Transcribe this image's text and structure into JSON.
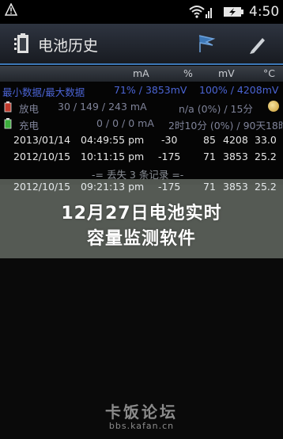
{
  "status_bar": {
    "time": "4:50"
  },
  "app_bar": {
    "title": "电池历史"
  },
  "table": {
    "columns": [
      "mA",
      "%",
      "mV",
      "°C"
    ],
    "max_min": {
      "label": "最小数据/最大数据",
      "pct": "71% / 3853mV",
      "mv": "100% / 4208mV"
    },
    "discharge": {
      "label": "放电",
      "values": "30 / 149 / 243 mA",
      "rate": "n/a (0%) / 15分"
    },
    "charge": {
      "label": "充电",
      "values": "0 / 0 / 0 mA",
      "rate": "2时10分 (0%) / 90天18时"
    },
    "rows": [
      {
        "date": "2013/01/14",
        "time": "04:49:55 pm",
        "ma": "-30",
        "pct": "85",
        "mv": "4208",
        "temp": "33.0"
      },
      {
        "date": "2012/10/15",
        "time": "10:11:15 pm",
        "ma": "-175",
        "pct": "71",
        "mv": "3853",
        "temp": "25.2"
      }
    ],
    "lost": "-= 丢失 3 条记录 =-",
    "partial_row": {
      "date": "2012/10/15",
      "time": "09:21:13 pm",
      "ma": "-175",
      "pct": "71",
      "mv": "3853",
      "temp": "25.2"
    }
  },
  "headline": {
    "line1": "12月27日电池实时",
    "line2": "容量监测软件"
  },
  "watermark": {
    "name": "卡饭论坛",
    "url": "bbs.kafan.cn"
  },
  "colors": {
    "accent": "#3d78b8",
    "maxmin": "#4b64d4",
    "discharge_icon": "#c0392b",
    "charge_icon": "#3cae3c"
  }
}
